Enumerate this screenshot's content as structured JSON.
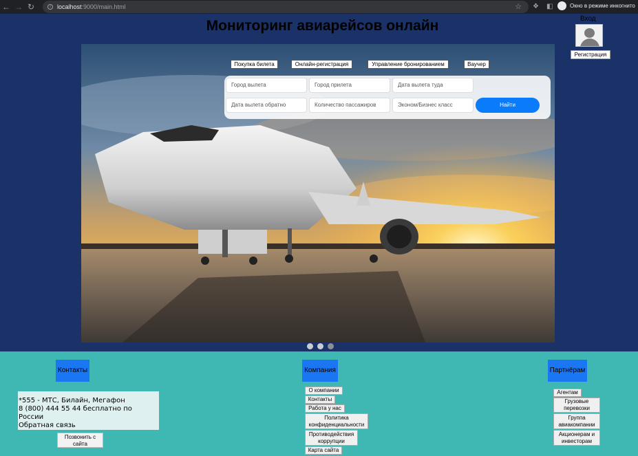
{
  "browser": {
    "url_host": "localhost",
    "url_path": ":9000/main.html",
    "incognito_label": "Окно в режиме инкогнито"
  },
  "header": {
    "title": "Мониторинг авиарейсов онлайн",
    "login_label": "Вход",
    "register_label": "Регистрация"
  },
  "tabs": [
    "Покупка билета",
    "Онлайн-регистрация",
    "Управление бронированием",
    "Ваучер"
  ],
  "search": {
    "from_placeholder": "Город вылета",
    "to_placeholder": "Город прилета",
    "depart_placeholder": "Дата вылета туда",
    "return_placeholder": "Дата вылета обратно",
    "passengers_placeholder": "Количество пассажиров",
    "class_placeholder": "Эконом/Бизнес класс",
    "find_label": "Найти"
  },
  "carousel": {
    "slides": 3,
    "active": 1
  },
  "footer": {
    "contacts": {
      "title": "Контакты",
      "lines": [
        "*555 - МТС, Билайн, Мегафон",
        "8 (800) 444 55 44 бесплатно по России",
        "Обратная связь"
      ],
      "call_label": "Позвонить с сайта"
    },
    "company": {
      "title": "Компания",
      "links": [
        "О компании",
        "Контакты",
        "Работа у нас",
        "Политика конфиденциальности",
        "Противодействия коррупции",
        "Карта сайта"
      ]
    },
    "partners": {
      "title": "Партнёрам",
      "links": [
        "Агентам",
        "Грузовые перевозки",
        "Группа авиакомпании",
        "Акционерам и инвесторам"
      ]
    }
  },
  "colors": {
    "page_bg": "#1b3268",
    "footer_bg": "#3fb8b3",
    "accent": "#0a7bfb",
    "section_head": "#1a76f2"
  }
}
